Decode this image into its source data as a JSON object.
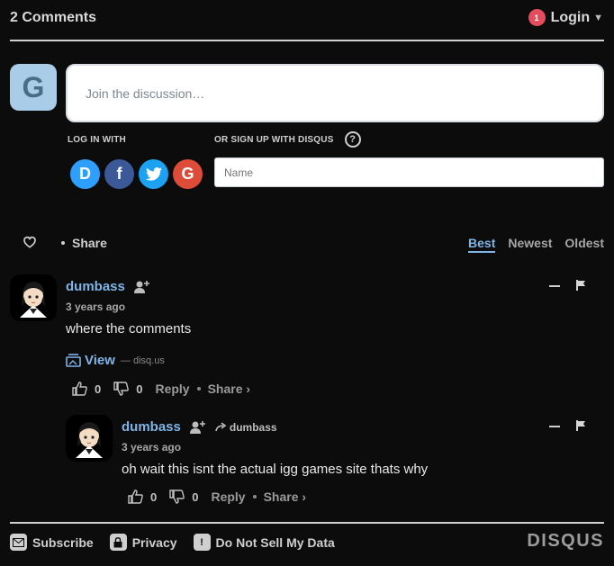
{
  "header": {
    "comment_count": "2 Comments",
    "notification_count": "1",
    "login_label": "Login"
  },
  "composer": {
    "guest_initial": "G",
    "placeholder": "Join the discussion…",
    "login_with_label": "LOG IN WITH",
    "signup_label": "OR SIGN UP WITH DISQUS",
    "help_glyph": "?",
    "name_placeholder": "Name",
    "social": [
      {
        "icon": "disqus-icon",
        "glyph": "D",
        "color": "#2e9fff"
      },
      {
        "icon": "facebook-icon",
        "glyph": "f",
        "color": "#3b5998"
      },
      {
        "icon": "twitter-icon",
        "glyph": "t",
        "color": "#1da1f2"
      },
      {
        "icon": "google-icon",
        "glyph": "G",
        "color": "#dd4b39"
      }
    ]
  },
  "nav": {
    "share_label": "Share",
    "sort_best": "Best",
    "sort_newest": "Newest",
    "sort_oldest": "Oldest"
  },
  "comments": [
    {
      "author": "dumbass",
      "time": "3 years ago",
      "text": "where the comments",
      "view_label": "View",
      "view_source": "— disq.us",
      "upvotes": "0",
      "downvotes": "0",
      "reply_label": "Reply",
      "share_label": "Share ›"
    },
    {
      "author": "dumbass",
      "reply_to": "dumbass",
      "time": "3 years ago",
      "text": "oh wait this isnt the actual igg games site thats why",
      "upvotes": "0",
      "downvotes": "0",
      "reply_label": "Reply",
      "share_label": "Share ›"
    }
  ],
  "footer": {
    "subscribe": "Subscribe",
    "privacy": "Privacy",
    "do_not_sell": "Do Not Sell My Data",
    "brand": "DISQUS"
  },
  "colors": {
    "accent": "#7fb4e6",
    "background": "#0c0c0d",
    "notification": "#e44d5d"
  }
}
